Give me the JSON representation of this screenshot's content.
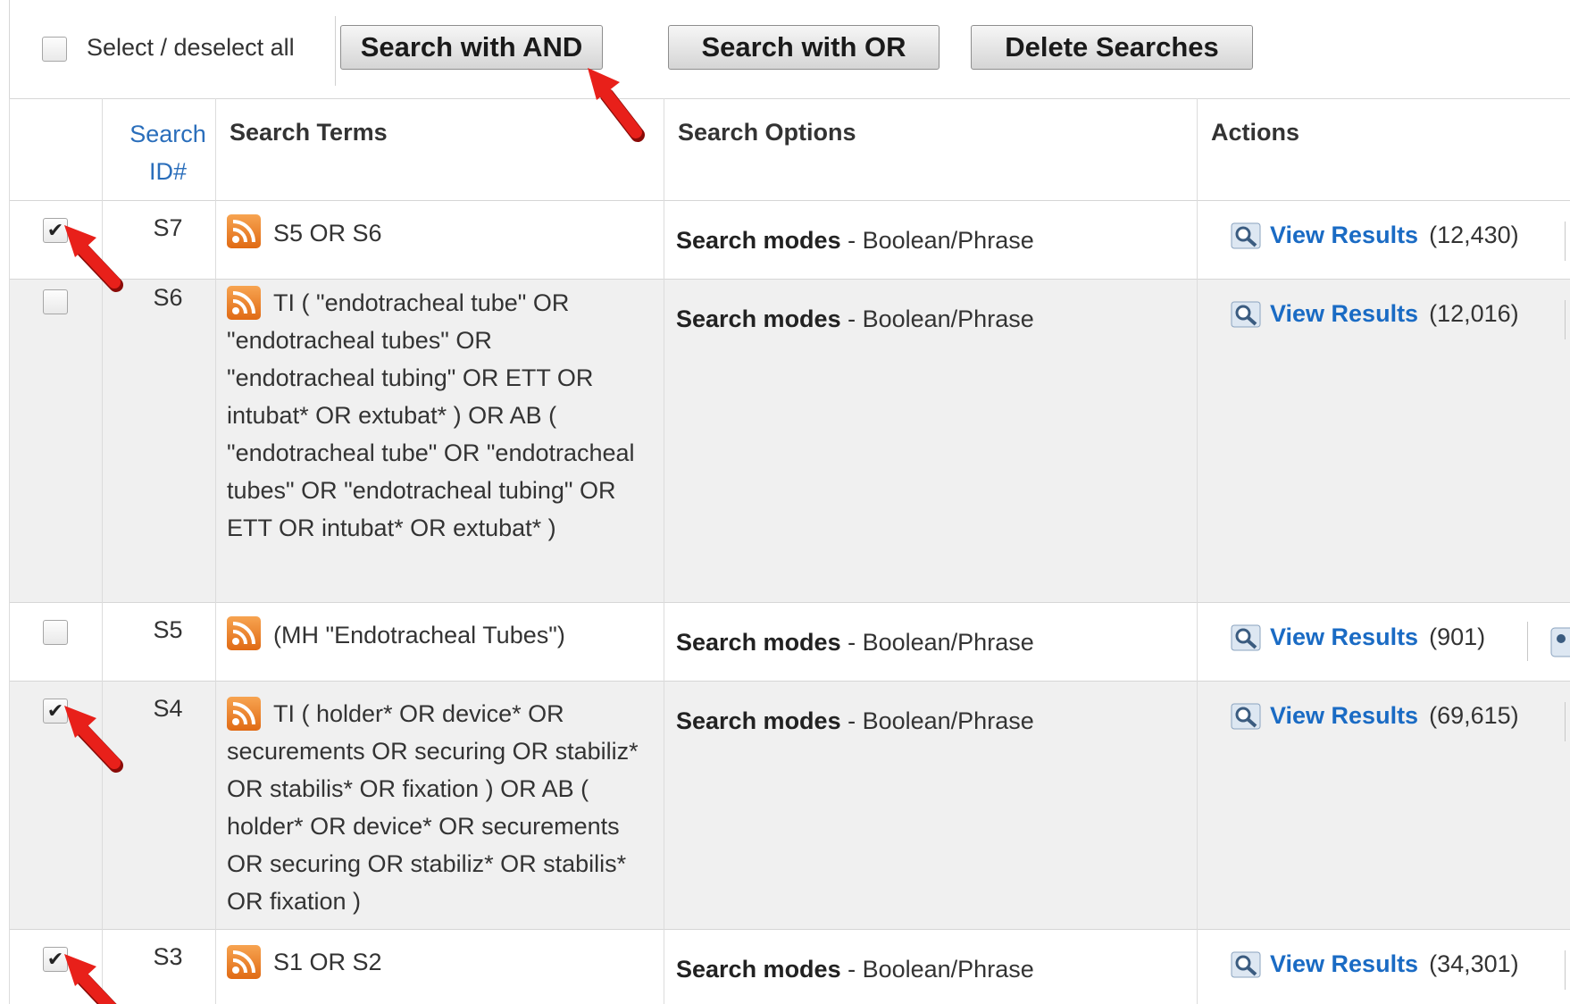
{
  "toolbar": {
    "select_all_label": "Select / deselect all",
    "search_and_label": "Search with AND",
    "search_or_label": "Search with OR",
    "delete_label": "Delete Searches"
  },
  "columns": {
    "id_line1": "Search",
    "id_line2": "ID#",
    "terms": "Search Terms",
    "options": "Search Options",
    "actions": "Actions"
  },
  "rows": [
    {
      "id": "S7",
      "checked": true,
      "terms": "S5 OR S6",
      "mode_label": "Search modes",
      "mode_value": " - Boolean/Phrase",
      "view_label": "View Results",
      "count": "(12,430)"
    },
    {
      "id": "S6",
      "checked": false,
      "terms": "TI ( \"endotracheal tube\" OR \"endotracheal tubes\" OR \"endotracheal tubing\" OR ETT OR intubat* OR extubat* ) OR AB ( \"endotracheal tube\" OR \"endotracheal tubes\" OR \"endotracheal tubing\" OR ETT OR intubat* OR extubat* )",
      "mode_label": "Search modes",
      "mode_value": " - Boolean/Phrase",
      "view_label": "View Results",
      "count": "(12,016)"
    },
    {
      "id": "S5",
      "checked": false,
      "terms": "(MH \"Endotracheal Tubes\")",
      "mode_label": "Search modes",
      "mode_value": " - Boolean/Phrase",
      "view_label": "View Results",
      "count": "(901)"
    },
    {
      "id": "S4",
      "checked": true,
      "terms": "TI ( holder* OR device* OR securements OR securing OR stabiliz* OR stabilis* OR fixation ) OR AB ( holder* OR device* OR securements OR securing OR stabiliz* OR stabilis* OR fixation )",
      "mode_label": "Search modes",
      "mode_value": " - Boolean/Phrase",
      "view_label": "View Results",
      "count": "(69,615)"
    },
    {
      "id": "S3",
      "checked": true,
      "terms": "S1 OR S2",
      "mode_label": "Search modes",
      "mode_value": " - Boolean/Phrase",
      "view_label": "View Results",
      "count": "(34,301)"
    }
  ],
  "colors": {
    "link_blue": "#1a6bc4",
    "header_blue": "#2a6ebb",
    "rss_orange": "#f08a2c",
    "arrow_red": "#e8201a",
    "alt_row": "#f0f0f0"
  },
  "icons": [
    "checkbox-icon",
    "rss-feed-icon",
    "magnifier-icon",
    "red-arrow-annotation"
  ]
}
